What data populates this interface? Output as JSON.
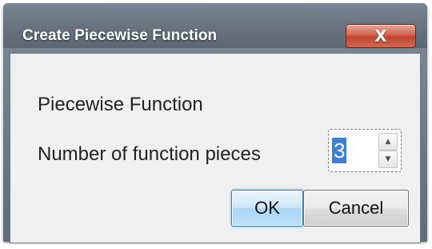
{
  "window": {
    "title": "Create Piecewise Function",
    "close_label": "X"
  },
  "dialog": {
    "heading": "Piecewise Function",
    "pieces_label": "Number of function pieces",
    "pieces_value": "3",
    "spin_up_glyph": "▲",
    "spin_down_glyph": "▼"
  },
  "buttons": {
    "ok_label": "OK",
    "cancel_label": "Cancel"
  },
  "colors": {
    "title_bar": "#66717d",
    "close_button": "#c04430",
    "selection": "#3d7fd6",
    "dialog_background": "#f0f0f0",
    "default_button": "#bfe0f7"
  }
}
